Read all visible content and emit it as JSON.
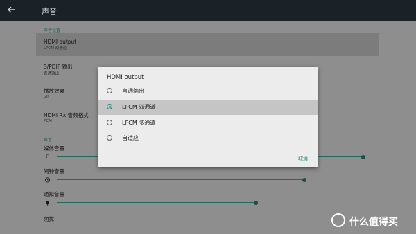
{
  "appbar": {
    "title": "声音"
  },
  "settings": {
    "section_display": "声音设置",
    "hdmi": {
      "title": "HDMI output",
      "subtitle": "LPCM 双通道"
    },
    "spdif": {
      "title": "S/PDIF 输出",
      "subtitle": "直通输出"
    },
    "playback": {
      "title": "播放效果",
      "subtitle": "off"
    },
    "hdmi_rx": {
      "title": "HDMI Rx 音频格式",
      "subtitle": "PCM"
    },
    "section_sound": "声音",
    "media_volume": {
      "title": "媒体音量",
      "level": 0.94
    },
    "alarm_volume": {
      "title": "闹钟音量",
      "level": 0.76
    },
    "notify_volume": {
      "title": "通知音量",
      "level": 0.61
    },
    "dnd": {
      "title": "勿扰"
    }
  },
  "dialog": {
    "title": "HDMI output",
    "options": [
      {
        "label": "直通输出",
        "selected": false
      },
      {
        "label": "LPCM 双通道",
        "selected": true
      },
      {
        "label": "LPCM 多通道",
        "selected": false
      },
      {
        "label": "自适应",
        "selected": false
      }
    ],
    "cancel_label": "取消"
  },
  "watermark": {
    "text": "什么值得买"
  },
  "colors": {
    "accent": "#1b8a78",
    "appbar": "#1a2127",
    "slider": "#1f6a5d"
  },
  "icons": {
    "back": "arrow-left-icon",
    "media": "music-note-icon",
    "alarm": "alarm-clock-icon",
    "notify": "bell-icon"
  }
}
